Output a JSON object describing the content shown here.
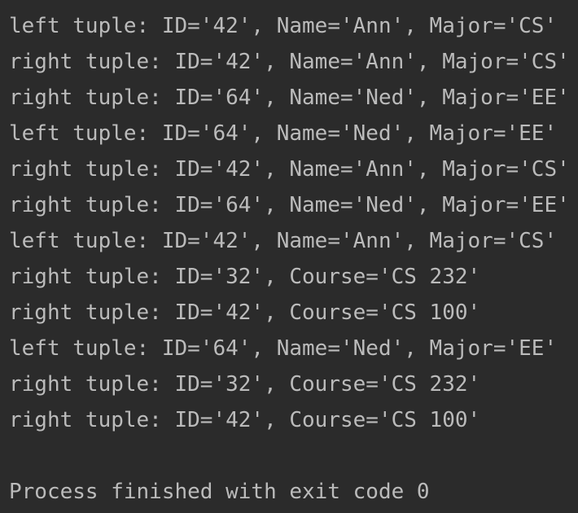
{
  "console": {
    "lines": [
      "left tuple: ID='42', Name='Ann', Major='CS'",
      "right tuple: ID='42', Name='Ann', Major='CS'",
      "right tuple: ID='64', Name='Ned', Major='EE'",
      "left tuple: ID='64', Name='Ned', Major='EE'",
      "right tuple: ID='42', Name='Ann', Major='CS'",
      "right tuple: ID='64', Name='Ned', Major='EE'",
      "left tuple: ID='42', Name='Ann', Major='CS'",
      "right tuple: ID='32', Course='CS 232'",
      "right tuple: ID='42', Course='CS 100'",
      "left tuple: ID='64', Name='Ned', Major='EE'",
      "right tuple: ID='32', Course='CS 232'",
      "right tuple: ID='42', Course='CS 100'"
    ],
    "exit_message": "Process finished with exit code 0"
  },
  "colors": {
    "background": "#2b2b2b",
    "text": "#bbbbbb"
  }
}
